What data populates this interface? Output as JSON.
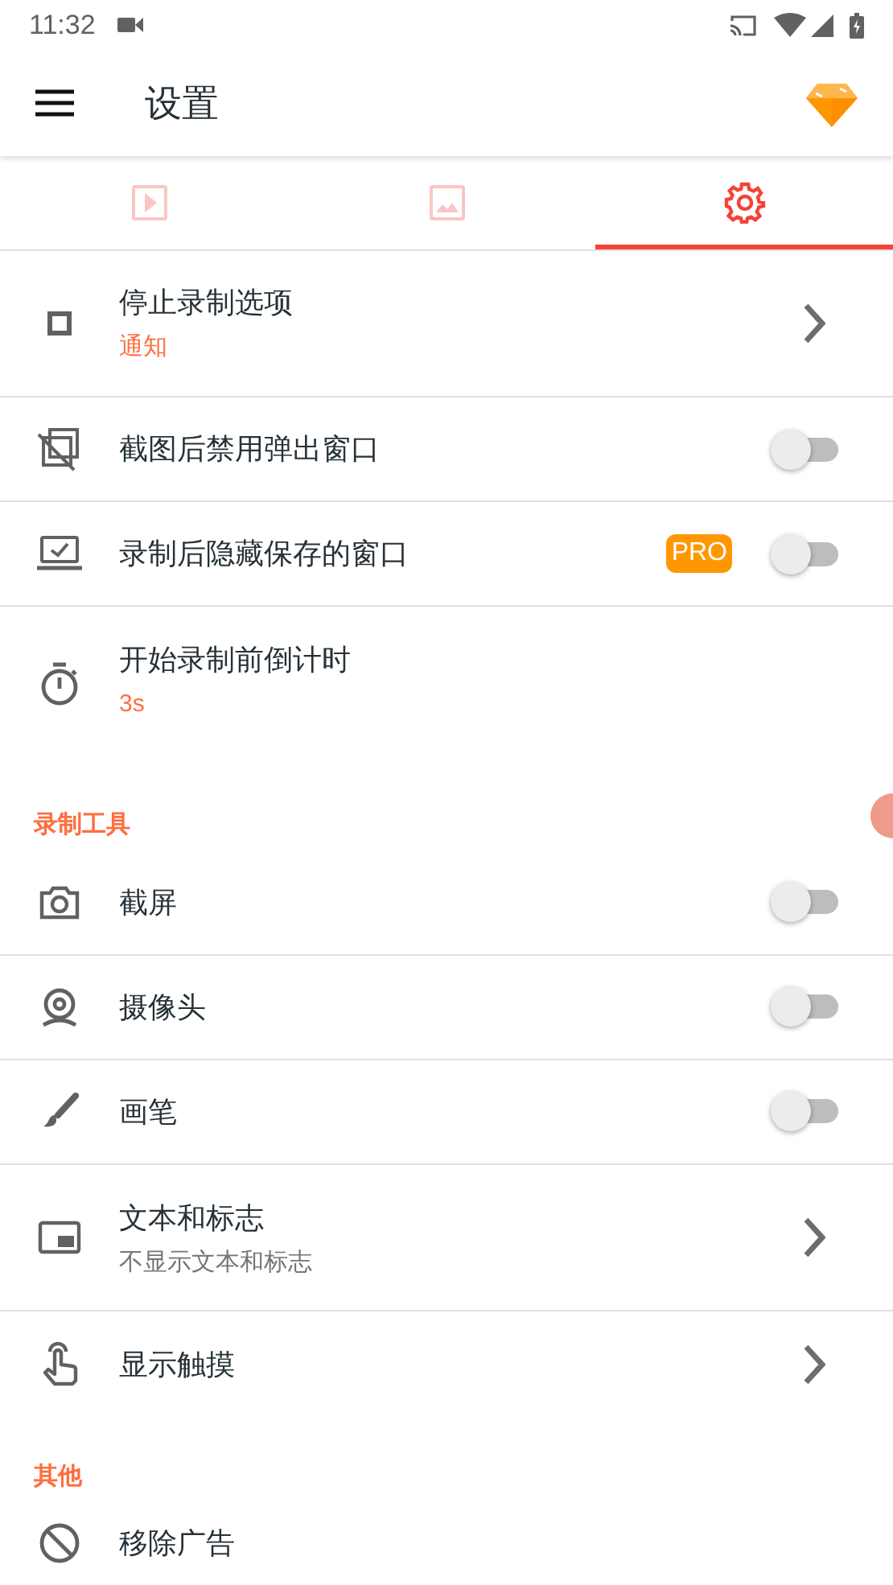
{
  "status_bar": {
    "time": "11:32"
  },
  "app_bar": {
    "title": "设置"
  },
  "tabs": [
    {
      "selected": false
    },
    {
      "selected": false
    },
    {
      "selected": true
    }
  ],
  "sections": [
    {
      "items": [
        {
          "kind": "nav",
          "title": "停止录制选项",
          "subtitle": "通知",
          "color": "#ff6e40"
        },
        {
          "kind": "toggle",
          "title": "截图后禁用弹出窗口",
          "on": false
        },
        {
          "kind": "toggle",
          "title": "录制后隐藏保存的窗口",
          "badge": "PRO",
          "on": false
        },
        {
          "kind": "info",
          "title": "开始录制前倒计时",
          "subtitle": "3s",
          "color": "#ff6e40"
        }
      ]
    },
    {
      "header": "录制工具",
      "items": [
        {
          "kind": "toggle",
          "title": "截屏",
          "on": false
        },
        {
          "kind": "toggle",
          "title": "摄像头",
          "on": false
        },
        {
          "kind": "toggle",
          "title": "画笔",
          "on": false
        },
        {
          "kind": "nav",
          "title": "文本和标志",
          "subtitle": "不显示文本和标志",
          "color": "#757575"
        },
        {
          "kind": "nav",
          "title": "显示触摸"
        }
      ]
    },
    {
      "header": "其他",
      "items": [
        {
          "kind": "info",
          "title": "移除广告"
        }
      ]
    }
  ]
}
